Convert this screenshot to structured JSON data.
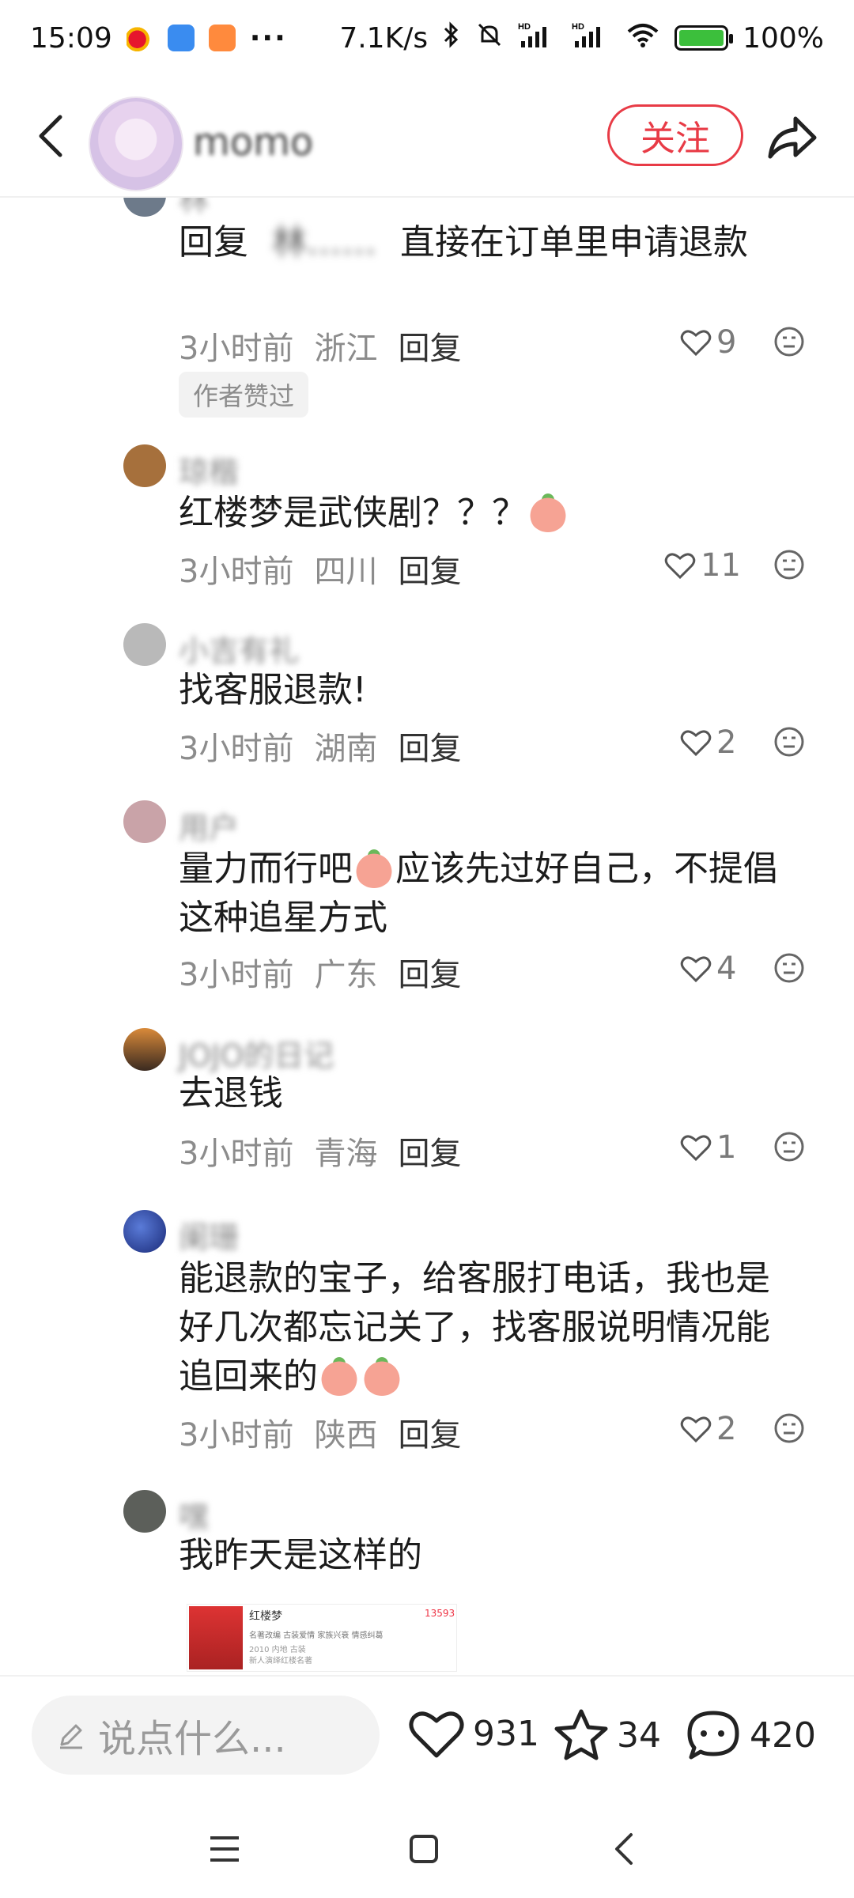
{
  "status_bar": {
    "time": "15:09",
    "dots": "···",
    "network_speed": "7.1K/s",
    "battery": "100%",
    "icons": [
      "weibo-icon",
      "app-blue-icon",
      "app-orange-icon",
      "bluetooth-icon",
      "mute-icon",
      "signal-hd-icon",
      "signal-hd-icon",
      "wifi-icon",
      "battery-icon"
    ]
  },
  "header": {
    "nickname": "momo",
    "follow_label": "关注",
    "icons": [
      "back-icon",
      "share-icon"
    ]
  },
  "comments": [
    {
      "name": "林",
      "text_parts": [
        "回复",
        "林……",
        "直接在订单里申请退款"
      ],
      "time": "3小时前",
      "location": "浙江",
      "reply_label": "回复",
      "likes": "9",
      "author_badge": "作者赞过"
    },
    {
      "name": "琼楷",
      "text": "红楼梦是武侠剧？？？",
      "time": "3小时前",
      "location": "四川",
      "reply_label": "回复",
      "likes": "11"
    },
    {
      "name": "小吉有礼",
      "text": "找客服退款!",
      "time": "3小时前",
      "location": "湖南",
      "reply_label": "回复",
      "likes": "2"
    },
    {
      "name": "用户",
      "text_a": "量力而行吧",
      "text_b": "应该先过好自己，不提倡这种追星方式",
      "time": "3小时前",
      "location": "广东",
      "reply_label": "回复",
      "likes": "4"
    },
    {
      "name": "JOJO的日记",
      "text": "去退钱",
      "time": "3小时前",
      "location": "青海",
      "reply_label": "回复",
      "likes": "1"
    },
    {
      "name": "阑珊",
      "text": "能退款的宝子，给客服打电话，我也是好几次都忘记关了，找客服说明情况能追回来的",
      "time": "3小时前",
      "location": "陕西",
      "reply_label": "回复",
      "likes": "2"
    },
    {
      "name": "嘿",
      "text": "我昨天是这样的",
      "attachment": {
        "title": "红楼梦",
        "count": "13593",
        "tags": "名著改编  古装爱情  家族兴衰  情感纠葛",
        "year": "2010 内地 古装",
        "desc": "新人演绎红楼名著"
      }
    }
  ],
  "bottom_bar": {
    "placeholder": "说点什么...",
    "likes": "931",
    "favorites": "34",
    "comments": "420"
  },
  "system_nav": [
    "menu-icon",
    "home-icon",
    "back-nav-icon"
  ]
}
